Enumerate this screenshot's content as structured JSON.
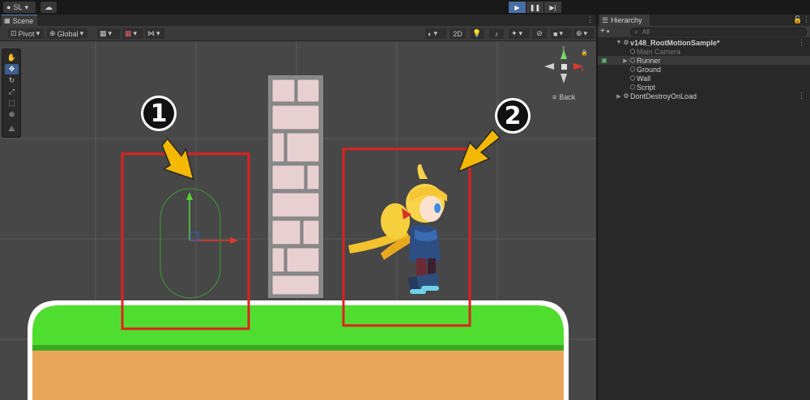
{
  "topbar": {
    "account_label": "SL",
    "account_icon": "user-icon",
    "cloud_icon": "cloud-icon",
    "play_icon": "play-icon",
    "pause_icon": "pause-icon",
    "step_icon": "step-icon",
    "play_glyph": "▶",
    "pause_glyph": "❚❚",
    "step_glyph": "▶|"
  },
  "scene": {
    "tab_label": "Scene",
    "tab_icon": "grid-icon",
    "pivot_label": "Pivot",
    "global_label": "Global",
    "mode_2d_label": "2D",
    "back_label": "Back",
    "accent_color": "#4a7ec0"
  },
  "hierarchy": {
    "tab_label": "Hierarchy",
    "add_label": "+",
    "search_placeholder": "All",
    "items": [
      {
        "label": "v148_RootMotionSample*",
        "type": "scene",
        "expanded": true
      },
      {
        "label": "Main Camera",
        "type": "gameobject",
        "disabled": true
      },
      {
        "label": "Runner",
        "type": "gameobject",
        "has_children": true,
        "selected": true
      },
      {
        "label": "Ground",
        "type": "gameobject"
      },
      {
        "label": "Wall",
        "type": "gameobject"
      },
      {
        "label": "Script",
        "type": "gameobject"
      },
      {
        "label": "DontDestroyOnLoad",
        "type": "scene",
        "expanded": false
      }
    ]
  },
  "annotations": {
    "marker_1": "1",
    "marker_2": "2",
    "box_color": "#e02020",
    "arrow_color": "#f5b800"
  },
  "gizmo": {
    "y_label": "y",
    "x_label": "x"
  }
}
